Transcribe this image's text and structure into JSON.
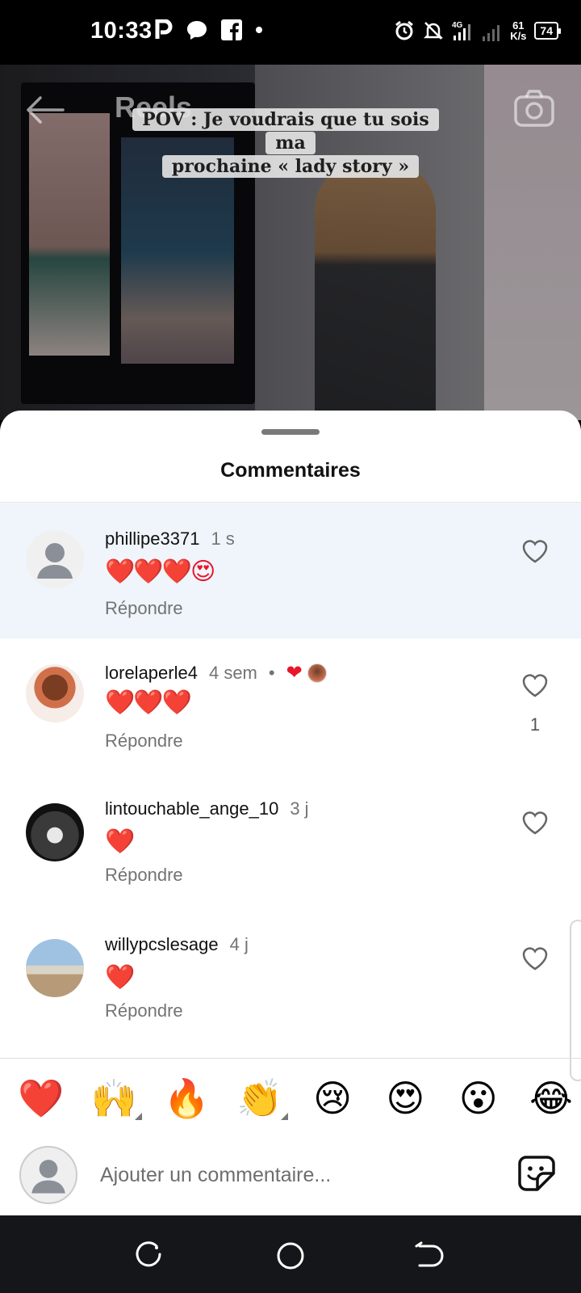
{
  "status_bar": {
    "time": "10:33",
    "left_icons": [
      "parking-icon",
      "chat-bubble-icon",
      "facebook-icon",
      "dot-icon"
    ],
    "right_icons": [
      "alarm-icon",
      "bell-off-icon",
      "signal-4g-icon",
      "signal-bars-icon"
    ],
    "net_type": "4G",
    "speed_value": "61",
    "speed_unit": "K/s",
    "battery": "74"
  },
  "video": {
    "header_title": "Reels",
    "caption_line1": "POV : Je voudrais que tu sois ma",
    "caption_line2": "prochaine « lady story »"
  },
  "sheet": {
    "title": "Commentaires"
  },
  "comments": [
    {
      "username": "phillipe3371",
      "time": "1 s",
      "text": "❤️❤️❤️😍",
      "reply_label": "Répondre",
      "likes": "",
      "highlighted": true
    },
    {
      "username": "lorelaperle4",
      "time": "4 sem",
      "separator": "•",
      "liked_by_author": "❤",
      "text": "❤️❤️❤️",
      "reply_label": "Répondre",
      "likes": "1"
    },
    {
      "username": "lintouchable_ange_10",
      "time": "3 j",
      "text": "❤️",
      "reply_label": "Répondre",
      "likes": ""
    },
    {
      "username": "willypcslesage",
      "time": "4 j",
      "text": "❤️",
      "reply_label": "Répondre",
      "likes": ""
    }
  ],
  "quick_emojis": [
    "❤️",
    "🙌",
    "🔥",
    "👏",
    "😢",
    "😍",
    "😮",
    "😂"
  ],
  "comment_input": {
    "placeholder": "Ajouter un commentaire...",
    "value": ""
  },
  "colors": {
    "heart_red": "#e8162b",
    "highlight_bg": "#eff5fb",
    "secondary_text": "#737373"
  }
}
